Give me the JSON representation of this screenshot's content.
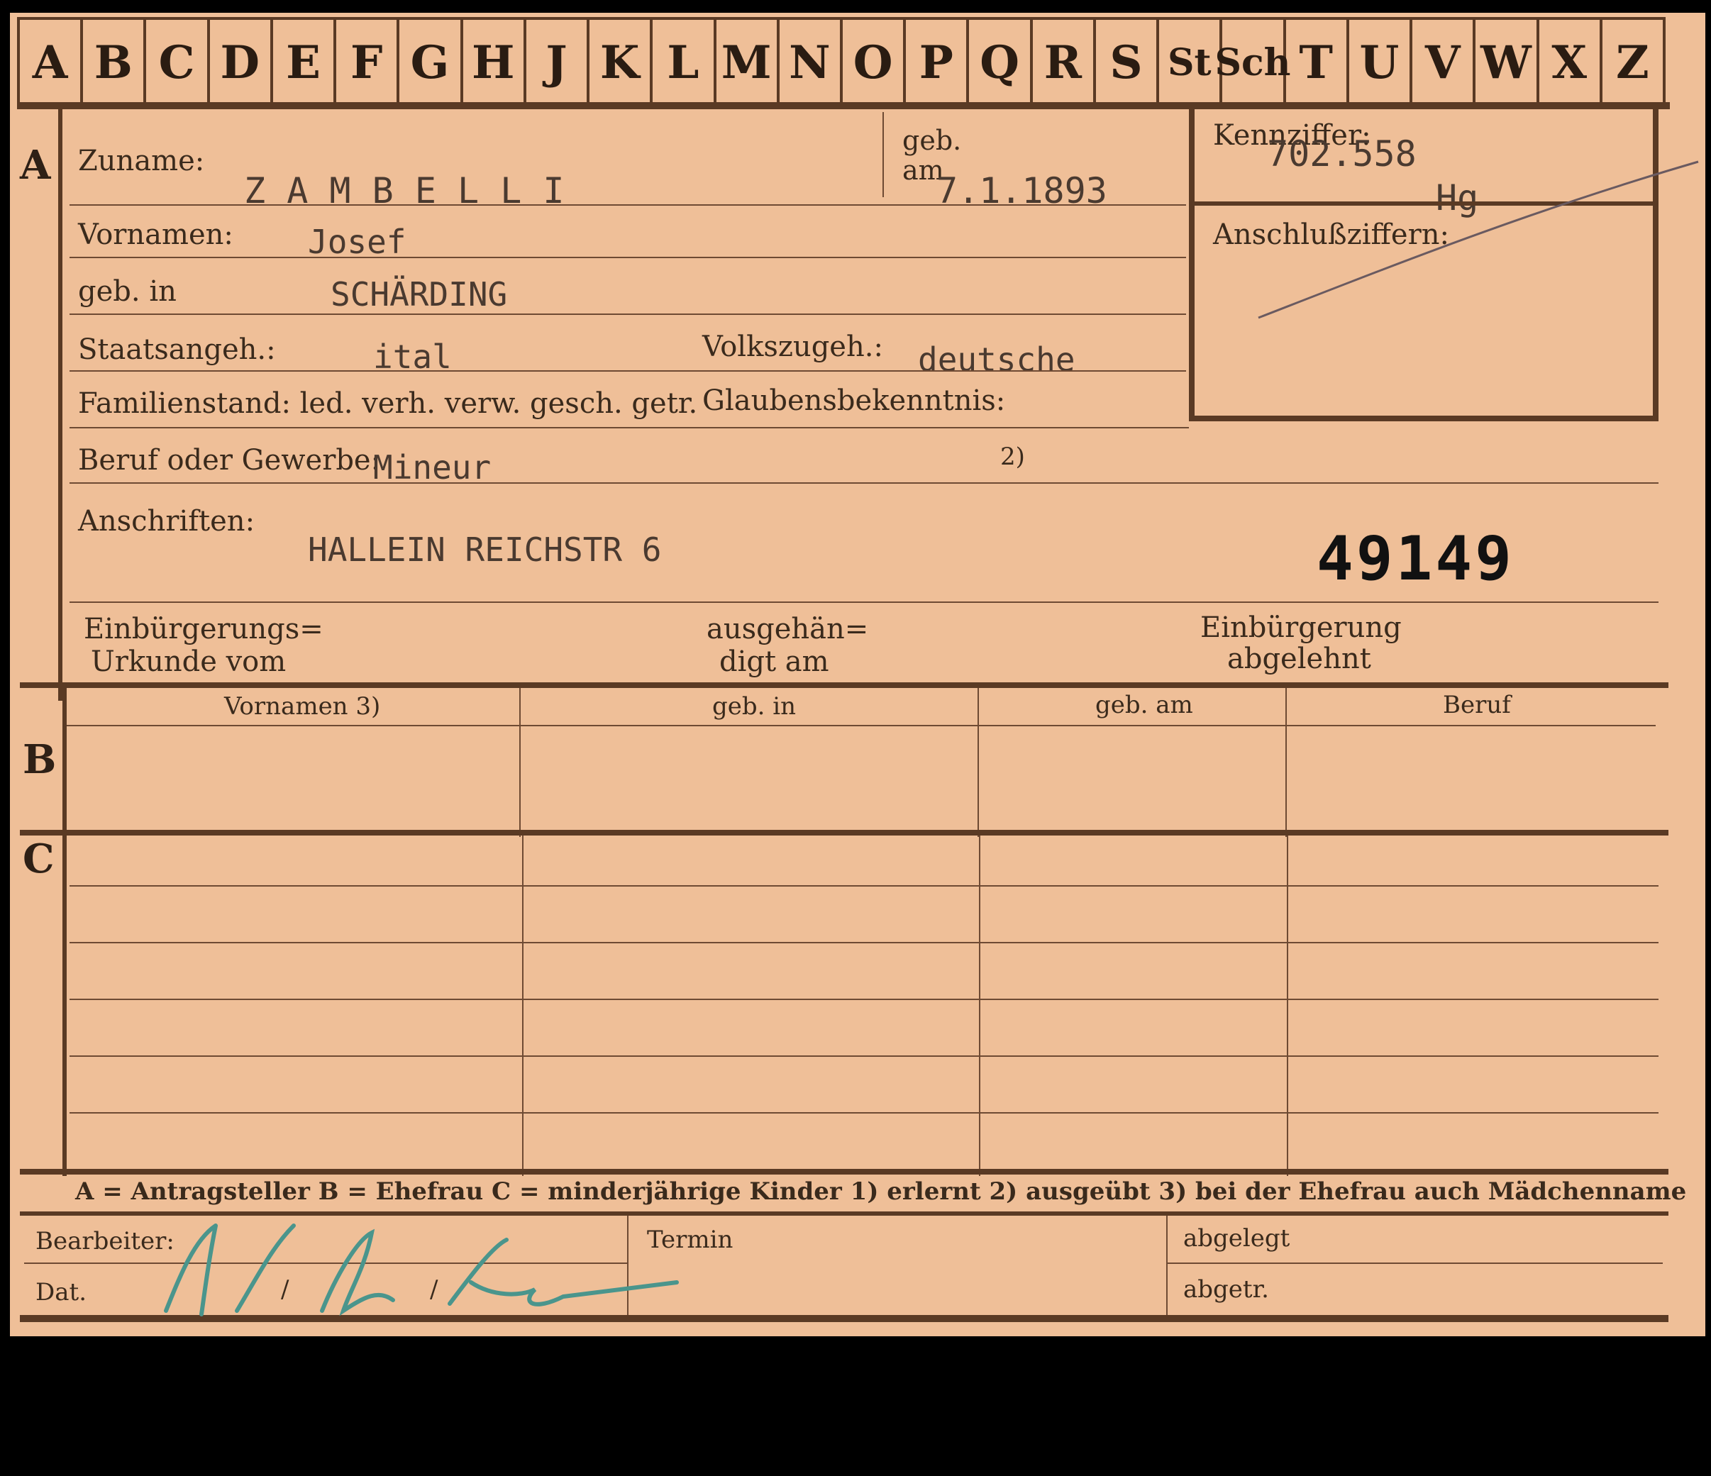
{
  "alphabet_tabs": [
    "A",
    "B",
    "C",
    "D",
    "E",
    "F",
    "G",
    "H",
    "J",
    "K",
    "L",
    "M",
    "N",
    "O",
    "P",
    "Q",
    "R",
    "S",
    "St",
    "Sch",
    "T",
    "U",
    "V",
    "W",
    "X",
    "Z"
  ],
  "section_labels": {
    "a": "A",
    "b": "B",
    "c": "C"
  },
  "fields": {
    "zuname_label": "Zuname:",
    "zuname_value": "Z A M B E L L I",
    "geb_label": "geb.",
    "am_label": "am",
    "geb_am_value": "7.1.1893",
    "kennziffer_label": "Kennziffer:",
    "kennziffer_value": "702.558",
    "kennziffer_suffix": "Hg",
    "anschluss_label": "Anschlußziffern:",
    "vornamen_label": "Vornamen:",
    "vornamen_value": "Josef",
    "geb_in_label": "geb. in",
    "geb_in_value": "SCHÄRDING",
    "staatsangeh_label": "Staatsangeh.:",
    "staatsangeh_value": "ital",
    "volkszugeh_label": "Volkszugeh.:",
    "volkszugeh_value": "deutsche",
    "familienstand_label": "Familienstand: led. verh. verw. gesch. getr.",
    "glaubens_label": "Glaubensbekenntnis:",
    "beruf_label": "Beruf oder Gewerbe:",
    "beruf_value": "Mineur",
    "beruf_note": "2)",
    "anschriften_label": "Anschriften:",
    "anschriften_value": "HALLEIN REICHSTR 6",
    "stamp_number": "49149",
    "einb_urkunde_label_1": "Einbürgerungs=",
    "einb_urkunde_label_2": "Urkunde vom",
    "ausgehaendigt_1": "ausgehän=",
    "ausgehaendigt_2": "digt am",
    "einb_abgelehnt_1": "Einbürgerung",
    "einb_abgelehnt_2": "abgelehnt"
  },
  "table_headers": [
    "Vornamen 3)",
    "geb. in",
    "geb. am",
    "Beruf"
  ],
  "legend": "A = Antragsteller   B = Ehefrau   C = minderjährige Kinder   1) erlernt   2) ausgeübt   3) bei der Ehefrau auch Mädchenname",
  "footer": {
    "bearbeiter_label": "Bearbeiter:",
    "dat_label": "Dat.",
    "slash_1": "/",
    "slash_2": "/",
    "termin_label": "Termin",
    "abgelegt_label": "abgelegt",
    "abgetr_label": "abgetr."
  },
  "colors": {
    "card": "#efbf98",
    "ink": "#3b2a1c",
    "rule": "#6e4a33",
    "signature": "#3f8f8a"
  }
}
